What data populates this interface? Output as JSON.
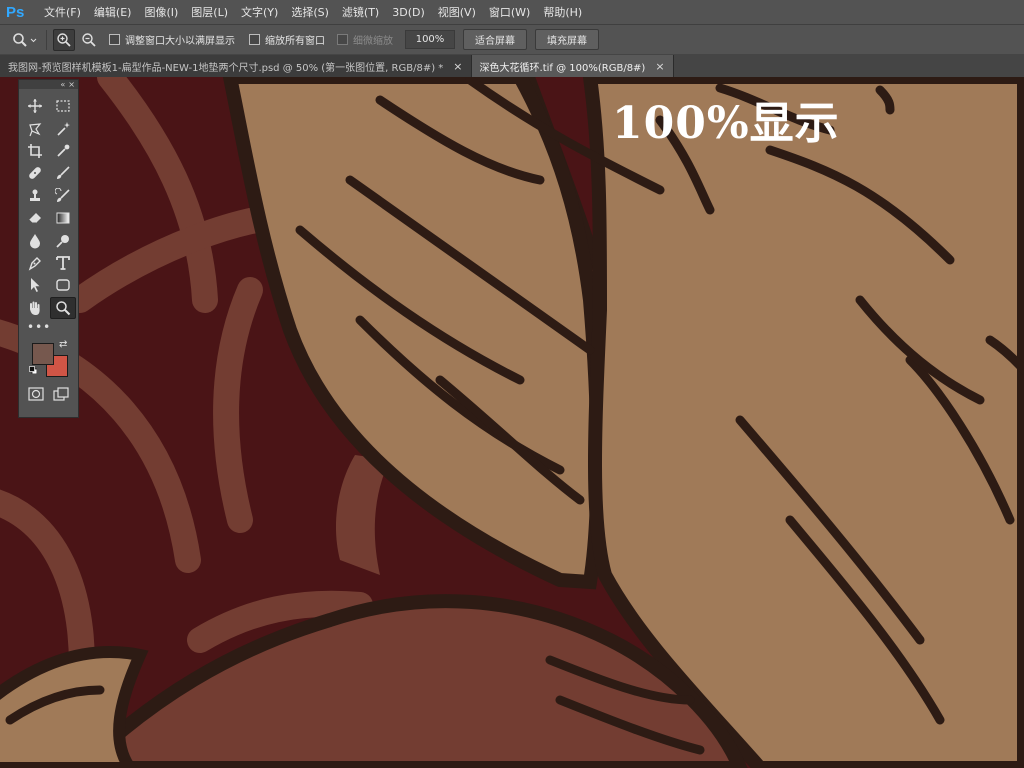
{
  "app": {
    "logo": "Ps"
  },
  "menu": {
    "items": [
      "文件(F)",
      "编辑(E)",
      "图像(I)",
      "图层(L)",
      "文字(Y)",
      "选择(S)",
      "滤镜(T)",
      "3D(D)",
      "视图(V)",
      "窗口(W)",
      "帮助(H)"
    ]
  },
  "options": {
    "resize_windows_label": "调整窗口大小以满屏显示",
    "zoom_all_windows_label": "缩放所有窗口",
    "scrubby_zoom_label": "细微缩放",
    "zoom_value": "100%",
    "fit_screen_label": "适合屏幕",
    "fill_screen_label": "填充屏幕"
  },
  "tabs": [
    {
      "label": "我图网-预览图样机模板1-扁型作品-NEW-1地垫两个尺寸.psd @ 50% (第一张图位置, RGB/8#) *",
      "close": "×"
    },
    {
      "label": "深色大花循环.tif @ 100%(RGB/8#)",
      "close": "×"
    }
  ],
  "overlay": {
    "title": "100%显示"
  },
  "toolbox": {
    "tools": [
      "move-tool",
      "marquee-tool",
      "lasso-tool",
      "magic-wand-tool",
      "crop-tool",
      "eyedropper-tool",
      "healing-brush-tool",
      "brush-tool",
      "clone-stamp-tool",
      "history-brush-tool",
      "eraser-tool",
      "gradient-tool",
      "blur-tool",
      "dodge-tool",
      "pen-tool",
      "type-tool",
      "path-selection-tool",
      "shape-tool",
      "hand-tool",
      "zoom-tool"
    ],
    "more": "•••",
    "foreground_color": "#76584e",
    "background_color": "#d05546"
  },
  "colors": {
    "ui_panel": "#535353",
    "canvas_dark": "#4a1416",
    "leaf_mid": "#733d32",
    "leaf_tan": "#a07a58",
    "outline": "#2d1b14"
  }
}
